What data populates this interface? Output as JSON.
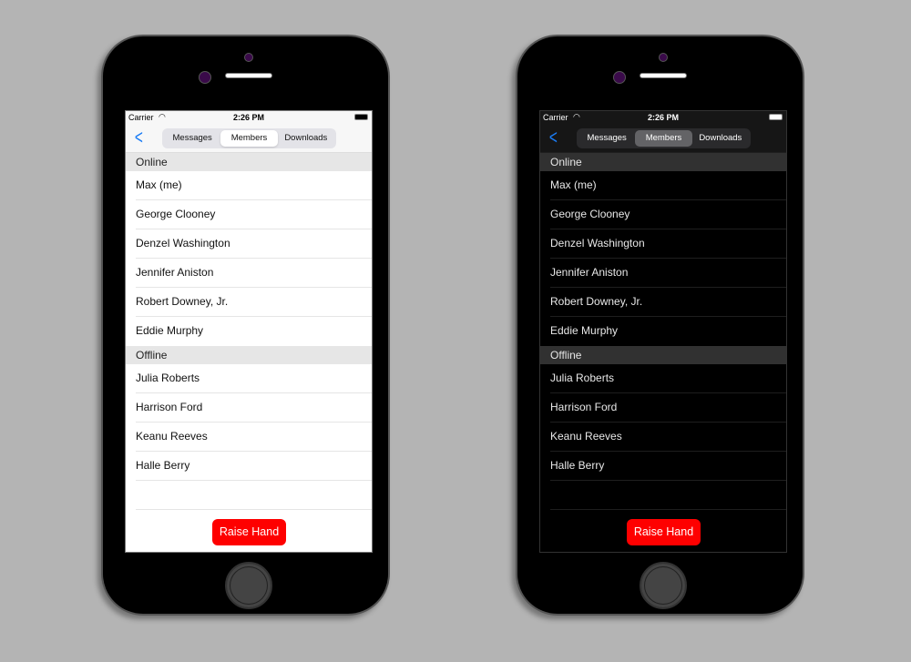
{
  "status_bar": {
    "carrier": "Carrier",
    "time": "2:26 PM",
    "wifi_icon": "wifi-icon",
    "battery_icon": "battery-icon"
  },
  "nav": {
    "back_icon": "chevron-left-icon",
    "back_glyph": "<",
    "segments": [
      "Messages",
      "Members",
      "Downloads"
    ],
    "selected_segment": "Members"
  },
  "sections": [
    {
      "header": "Online",
      "members": [
        "Max (me)",
        "George Clooney",
        "Denzel Washington",
        "Jennifer Aniston",
        "Robert Downey, Jr.",
        "Eddie Murphy"
      ]
    },
    {
      "header": "Offline",
      "members": [
        "Julia Roberts",
        "Harrison Ford",
        "Keanu Reeves",
        "Halle Berry"
      ]
    }
  ],
  "raise_hand_label": "Raise Hand",
  "colors": {
    "accent": "#1a7cf5",
    "raise_hand": "#fe0000",
    "background": "#b4b4b4"
  },
  "themes": [
    "light",
    "dark"
  ]
}
